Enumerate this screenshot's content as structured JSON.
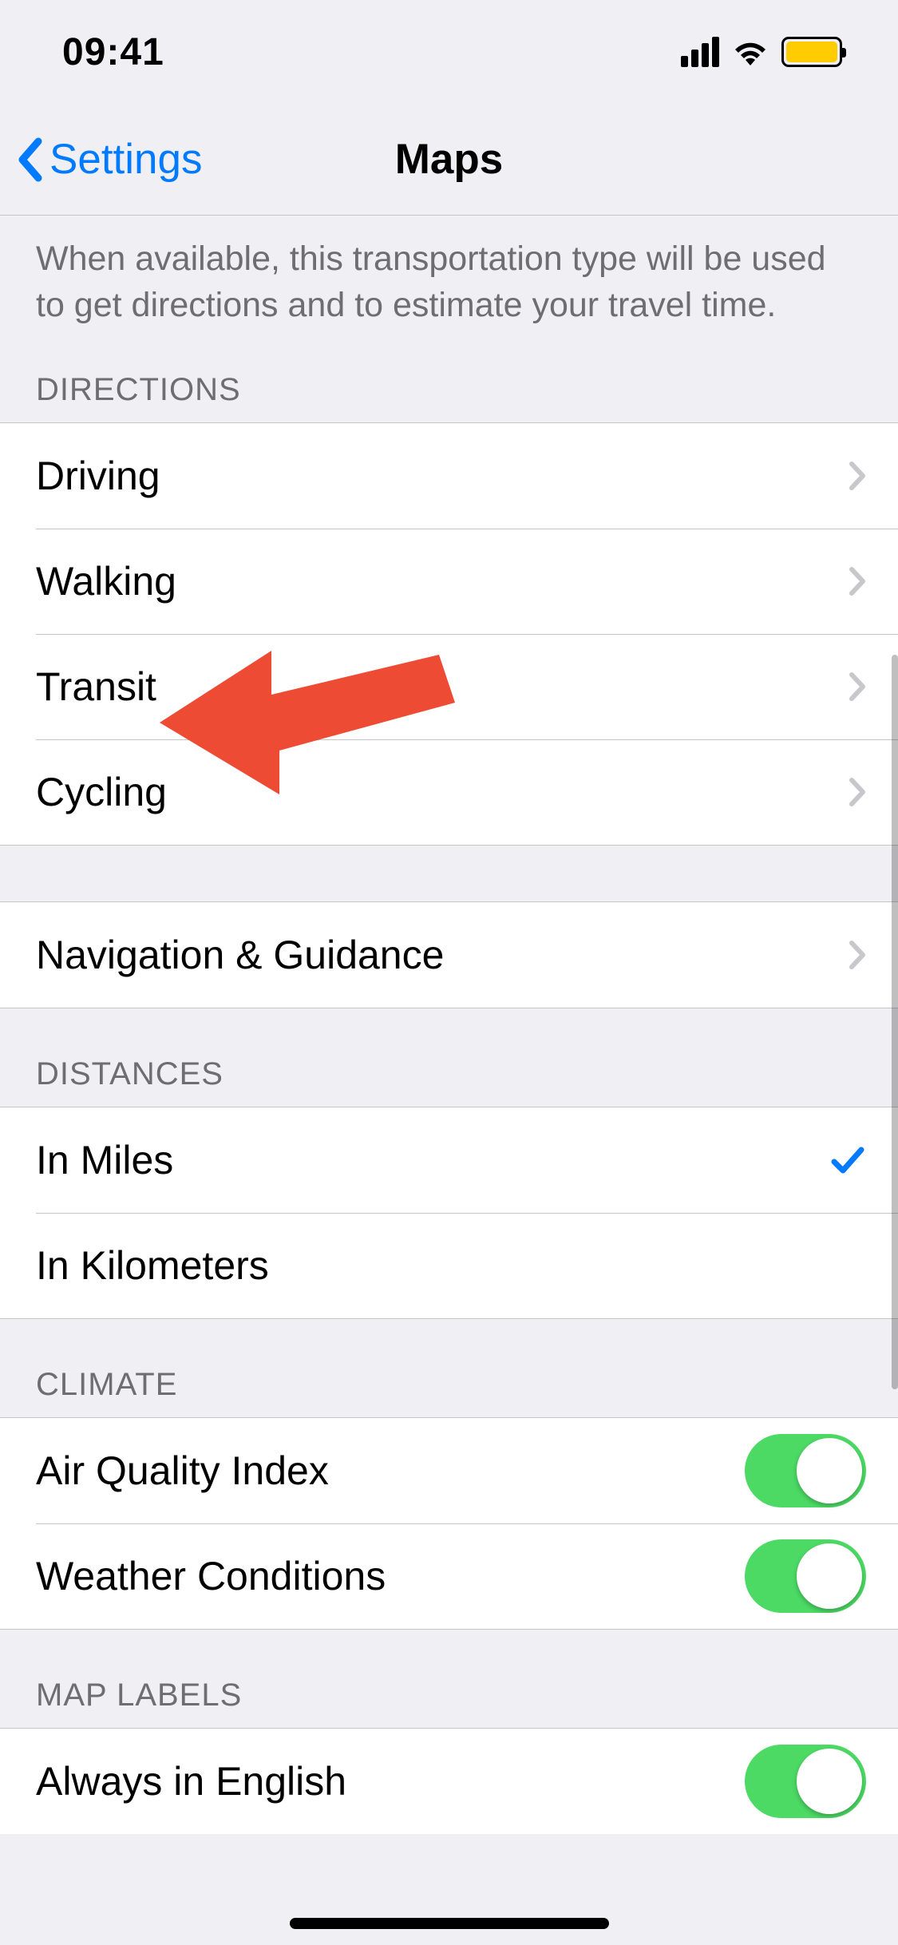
{
  "status": {
    "time": "09:41"
  },
  "nav": {
    "back": "Settings",
    "title": "Maps"
  },
  "description": "When available, this transportation type will be used to get directions and to estimate your travel time.",
  "sections": {
    "directions": {
      "header": "DIRECTIONS",
      "items": [
        "Driving",
        "Walking",
        "Transit",
        "Cycling"
      ]
    },
    "nav_guidance": {
      "label": "Navigation & Guidance"
    },
    "distances": {
      "header": "DISTANCES",
      "items": [
        "In Miles",
        "In Kilometers"
      ],
      "selected": 0
    },
    "climate": {
      "header": "CLIMATE",
      "items": [
        "Air Quality Index",
        "Weather Conditions"
      ],
      "toggles": [
        true,
        true
      ]
    },
    "map_labels": {
      "header": "MAP LABELS",
      "items": [
        "Always in English"
      ],
      "toggles": [
        true
      ]
    }
  },
  "colors": {
    "link": "#007aff",
    "toggle_on": "#4cd964",
    "battery": "#ffcc00",
    "annotation_arrow": "#ed4b34"
  }
}
